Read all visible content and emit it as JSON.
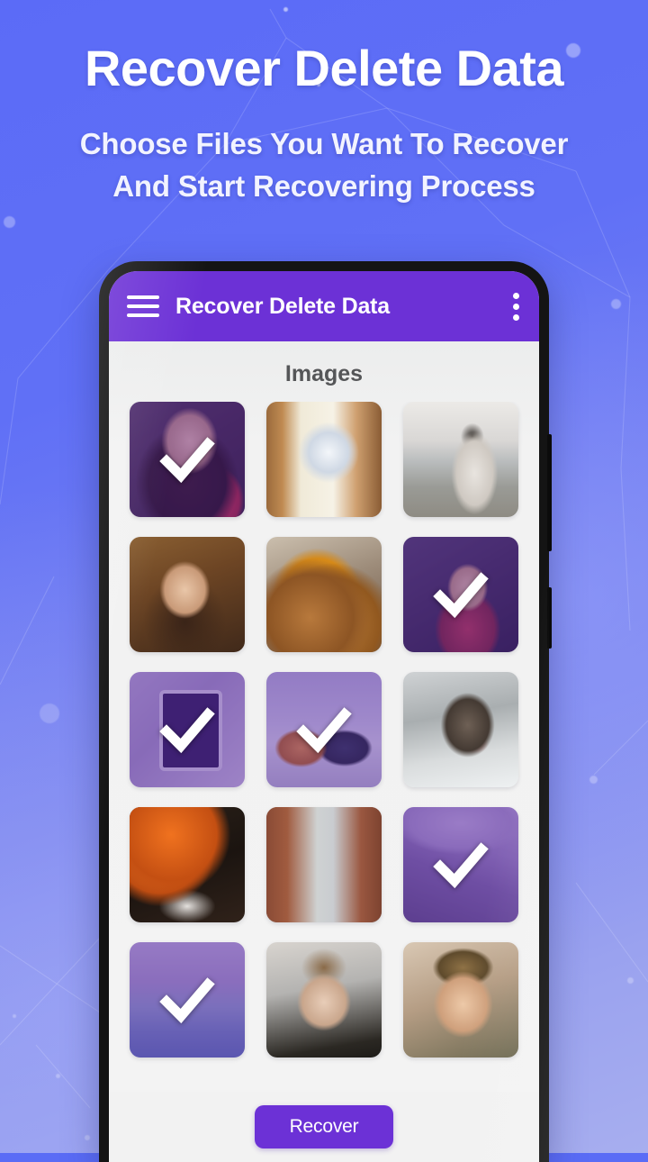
{
  "promo": {
    "headline": "Recover Delete Data",
    "subline_1": "Choose Files You Want To Recover",
    "subline_2": "And Start Recovering Process"
  },
  "colors": {
    "primary_purple": "#6c31d6",
    "promo_background_start": "#5b6bf7",
    "promo_background_end": "#a7aeef",
    "screen_background": "#f2f2f2",
    "selection_tint": "rgba(92,45,160,0.40)",
    "check_color": "#ffffff"
  },
  "app": {
    "appbar": {
      "menu_icon": "hamburger-menu-icon",
      "title": "Recover Delete Data",
      "overflow_icon": "more-vertical-icon"
    },
    "section_title": "Images",
    "grid": {
      "columns": 3,
      "items": [
        {
          "label": "portrait-woman-red-jacket",
          "art": "a-portrait-red",
          "selected": true
        },
        {
          "label": "hands-holding-crystal-ball",
          "art": "a-crystal",
          "selected": false
        },
        {
          "label": "woman-white-dress-beach",
          "art": "a-beach",
          "selected": false
        },
        {
          "label": "portrait-woman-warm-light",
          "art": "a-portrait-asian",
          "selected": false
        },
        {
          "label": "falafel-food-platter",
          "art": "a-food",
          "selected": false
        },
        {
          "label": "woman-red-top-foliage",
          "art": "a-portrait-leaves",
          "selected": true
        },
        {
          "label": "tablet-on-knit-blanket",
          "art": "a-tablet",
          "selected": true
        },
        {
          "label": "two-sports-cars-snow",
          "art": "a-cars",
          "selected": true
        },
        {
          "label": "husky-dog-in-snow",
          "art": "a-dog",
          "selected": false
        },
        {
          "label": "red-lanterns-street",
          "art": "a-lanterns",
          "selected": false
        },
        {
          "label": "city-street-skybridge",
          "art": "a-street",
          "selected": false
        },
        {
          "label": "person-walking-sand-dunes",
          "art": "a-dunes",
          "selected": true
        },
        {
          "label": "snowboarder-on-slope",
          "art": "a-snowboard",
          "selected": true
        },
        {
          "label": "woman-portrait-snowfall",
          "art": "a-snowgirl",
          "selected": false
        },
        {
          "label": "man-portrait-smiling",
          "art": "a-manface",
          "selected": false
        }
      ]
    },
    "bottom_bar": {
      "recover_label": "Recover"
    }
  }
}
